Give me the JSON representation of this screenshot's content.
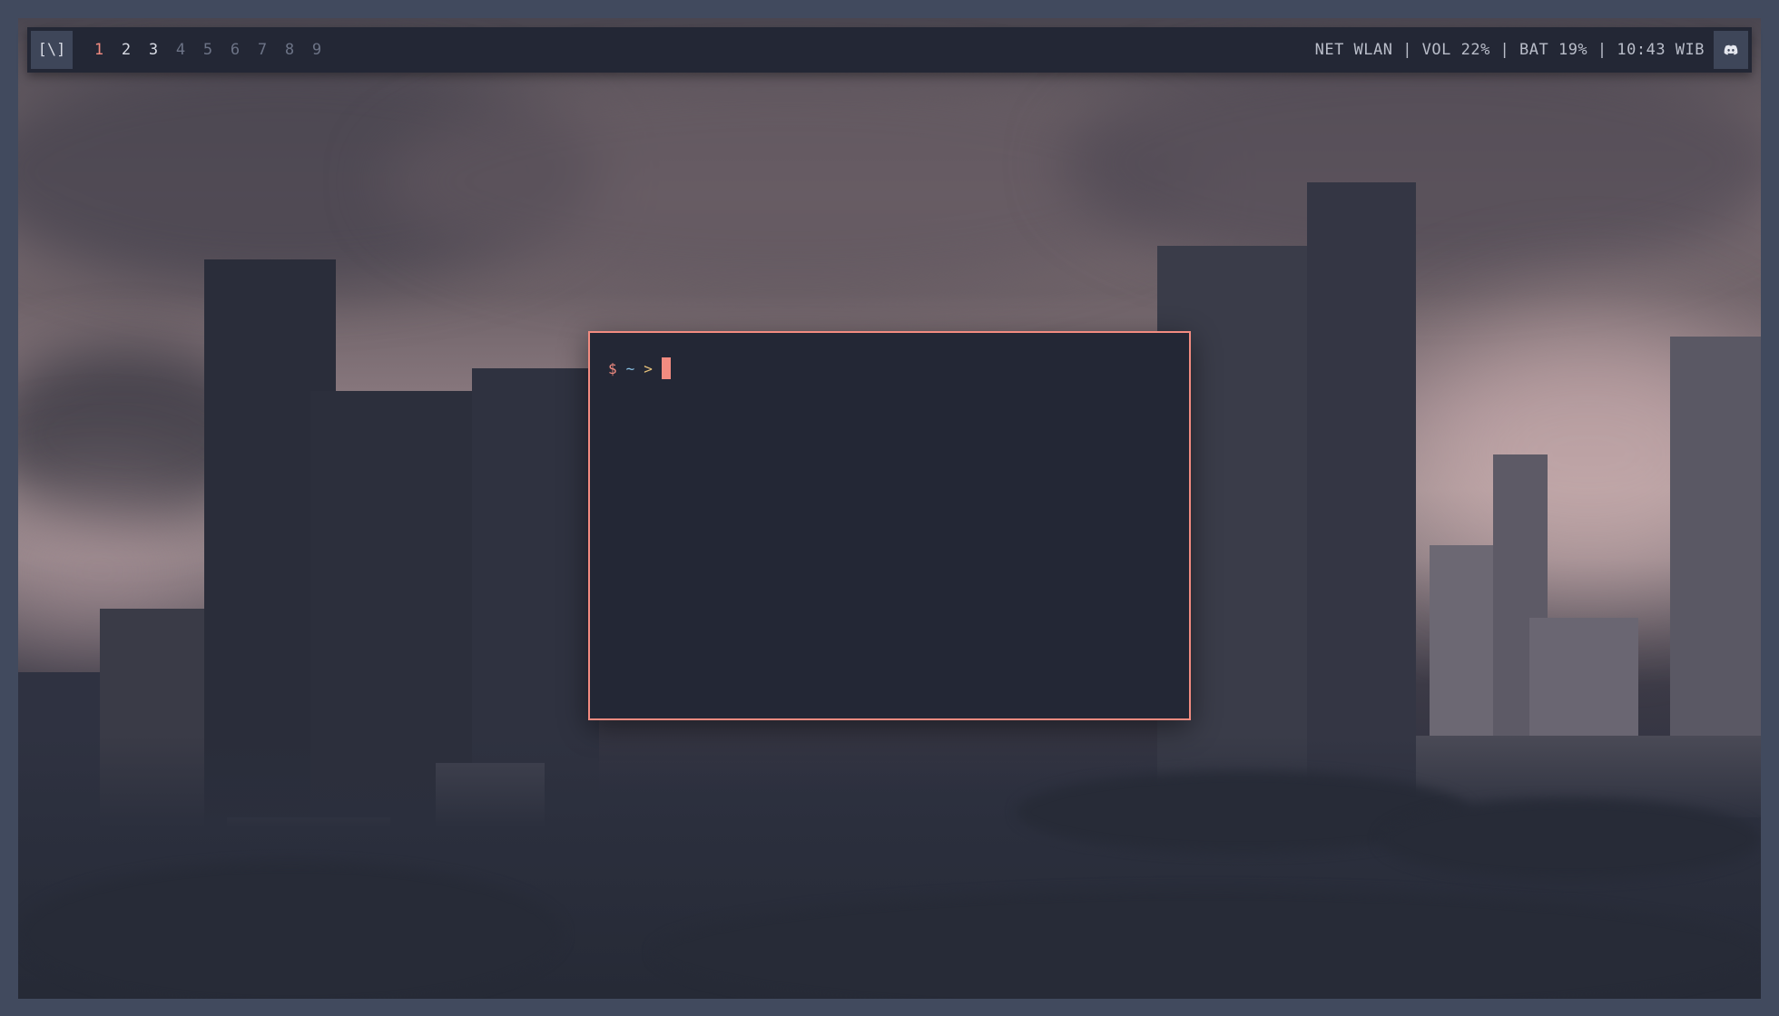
{
  "bar": {
    "layout_symbol": "[\\]",
    "tags": [
      {
        "label": "1",
        "state": "active"
      },
      {
        "label": "2",
        "state": "occupied"
      },
      {
        "label": "3",
        "state": "occupied"
      },
      {
        "label": "4",
        "state": "empty"
      },
      {
        "label": "5",
        "state": "empty"
      },
      {
        "label": "6",
        "state": "empty"
      },
      {
        "label": "7",
        "state": "empty"
      },
      {
        "label": "8",
        "state": "empty"
      },
      {
        "label": "9",
        "state": "empty"
      }
    ],
    "status": "NET WLAN | VOL 22% | BAT 19% | 10:43 WIB",
    "tray_icon": "discord-icon"
  },
  "terminal": {
    "prompt_symbol": "$",
    "prompt_dir": "~",
    "prompt_arrow": ">"
  },
  "colors": {
    "accent": "#f28b80",
    "background": "#232735",
    "tag_occupied": "#d8dbe4",
    "tag_empty": "#6c7386",
    "prompt_dir": "#89c2e6",
    "prompt_arrow": "#e6c27a"
  }
}
